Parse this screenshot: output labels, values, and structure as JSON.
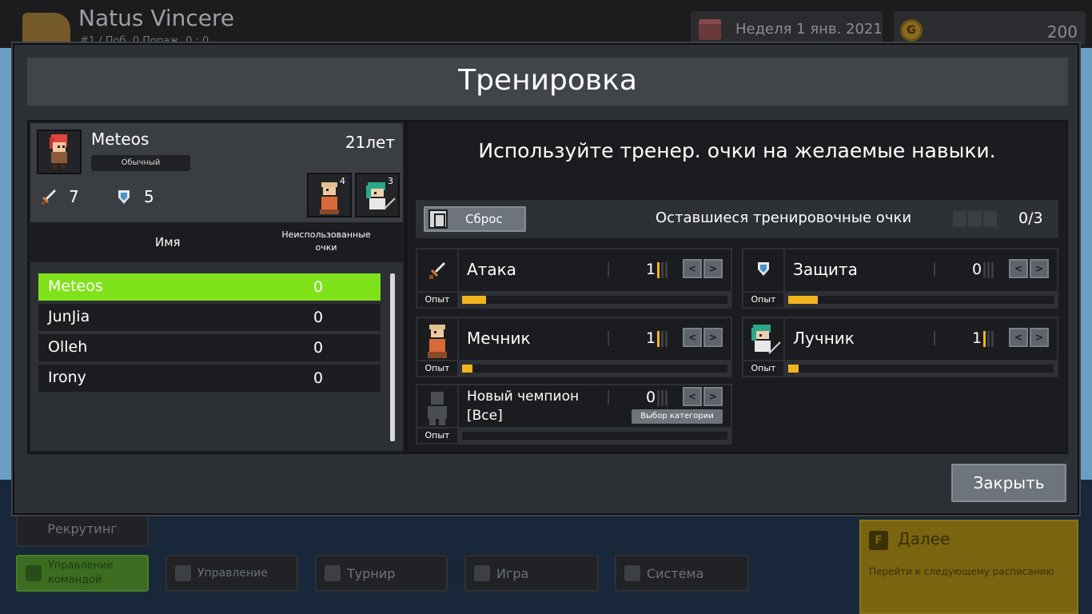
{
  "background": {
    "team_name": "Natus Vincere",
    "team_stats": "#1 / Поб. 0 Пораж. 0 : 0",
    "date": "Неделя 1 янв. 2021",
    "money": "200",
    "coin_letter": "G",
    "recruit_label": "Рекрутинг",
    "nav": {
      "team": "Управление командой",
      "manage": "Управление",
      "tournament": "Турнир",
      "game": "Игра",
      "system": "Система"
    },
    "next": {
      "key": "F",
      "title": "Далее",
      "subtitle": "Перейти к следующему расписанию"
    }
  },
  "modal": {
    "title": "Тренировка",
    "close_label": "Закрыть"
  },
  "player": {
    "name": "Meteos",
    "tag": "Обычный",
    "age": "21лет",
    "attack": "7",
    "defense": "5",
    "champions": [
      {
        "icon": "swordsman-portrait-icon",
        "level": "4"
      },
      {
        "icon": "archer-portrait-icon",
        "level": "3"
      }
    ]
  },
  "roster": {
    "col_name": "Имя",
    "col_points": "Неиспользованные очки",
    "rows": [
      {
        "name": "Meteos",
        "points": "0",
        "selected": true
      },
      {
        "name": "JunJia",
        "points": "0",
        "selected": false
      },
      {
        "name": "Olleh",
        "points": "0",
        "selected": false
      },
      {
        "name": "Irony",
        "points": "0",
        "selected": false
      }
    ]
  },
  "training": {
    "instructions": "Используйте тренер. очки на желаемые навыки.",
    "reset_label": "Сброс",
    "remaining_label": "Оставшиеся тренировочные очки",
    "remaining_value": "0/3",
    "xp_label": "Опыт",
    "skills": [
      {
        "name": "Атака",
        "level": "1",
        "xp_fraction": 0.09,
        "icon": "sword-icon"
      },
      {
        "name": "Защита",
        "level": "0",
        "xp_fraction": 0.11,
        "icon": "shield-icon"
      },
      {
        "name": "Мечник",
        "level": "1",
        "xp_fraction": 0.04,
        "icon": "swordsman-icon"
      },
      {
        "name": "Лучник",
        "level": "1",
        "xp_fraction": 0.04,
        "icon": "archer-icon"
      }
    ],
    "new_champion": {
      "name": "Новый чемпион",
      "category": "[Все]",
      "level": "0",
      "category_button": "Выбор категории",
      "xp_fraction": 0
    }
  },
  "colors": {
    "accent_green": "#7fe21a",
    "xp_gold": "#f2b41c"
  }
}
